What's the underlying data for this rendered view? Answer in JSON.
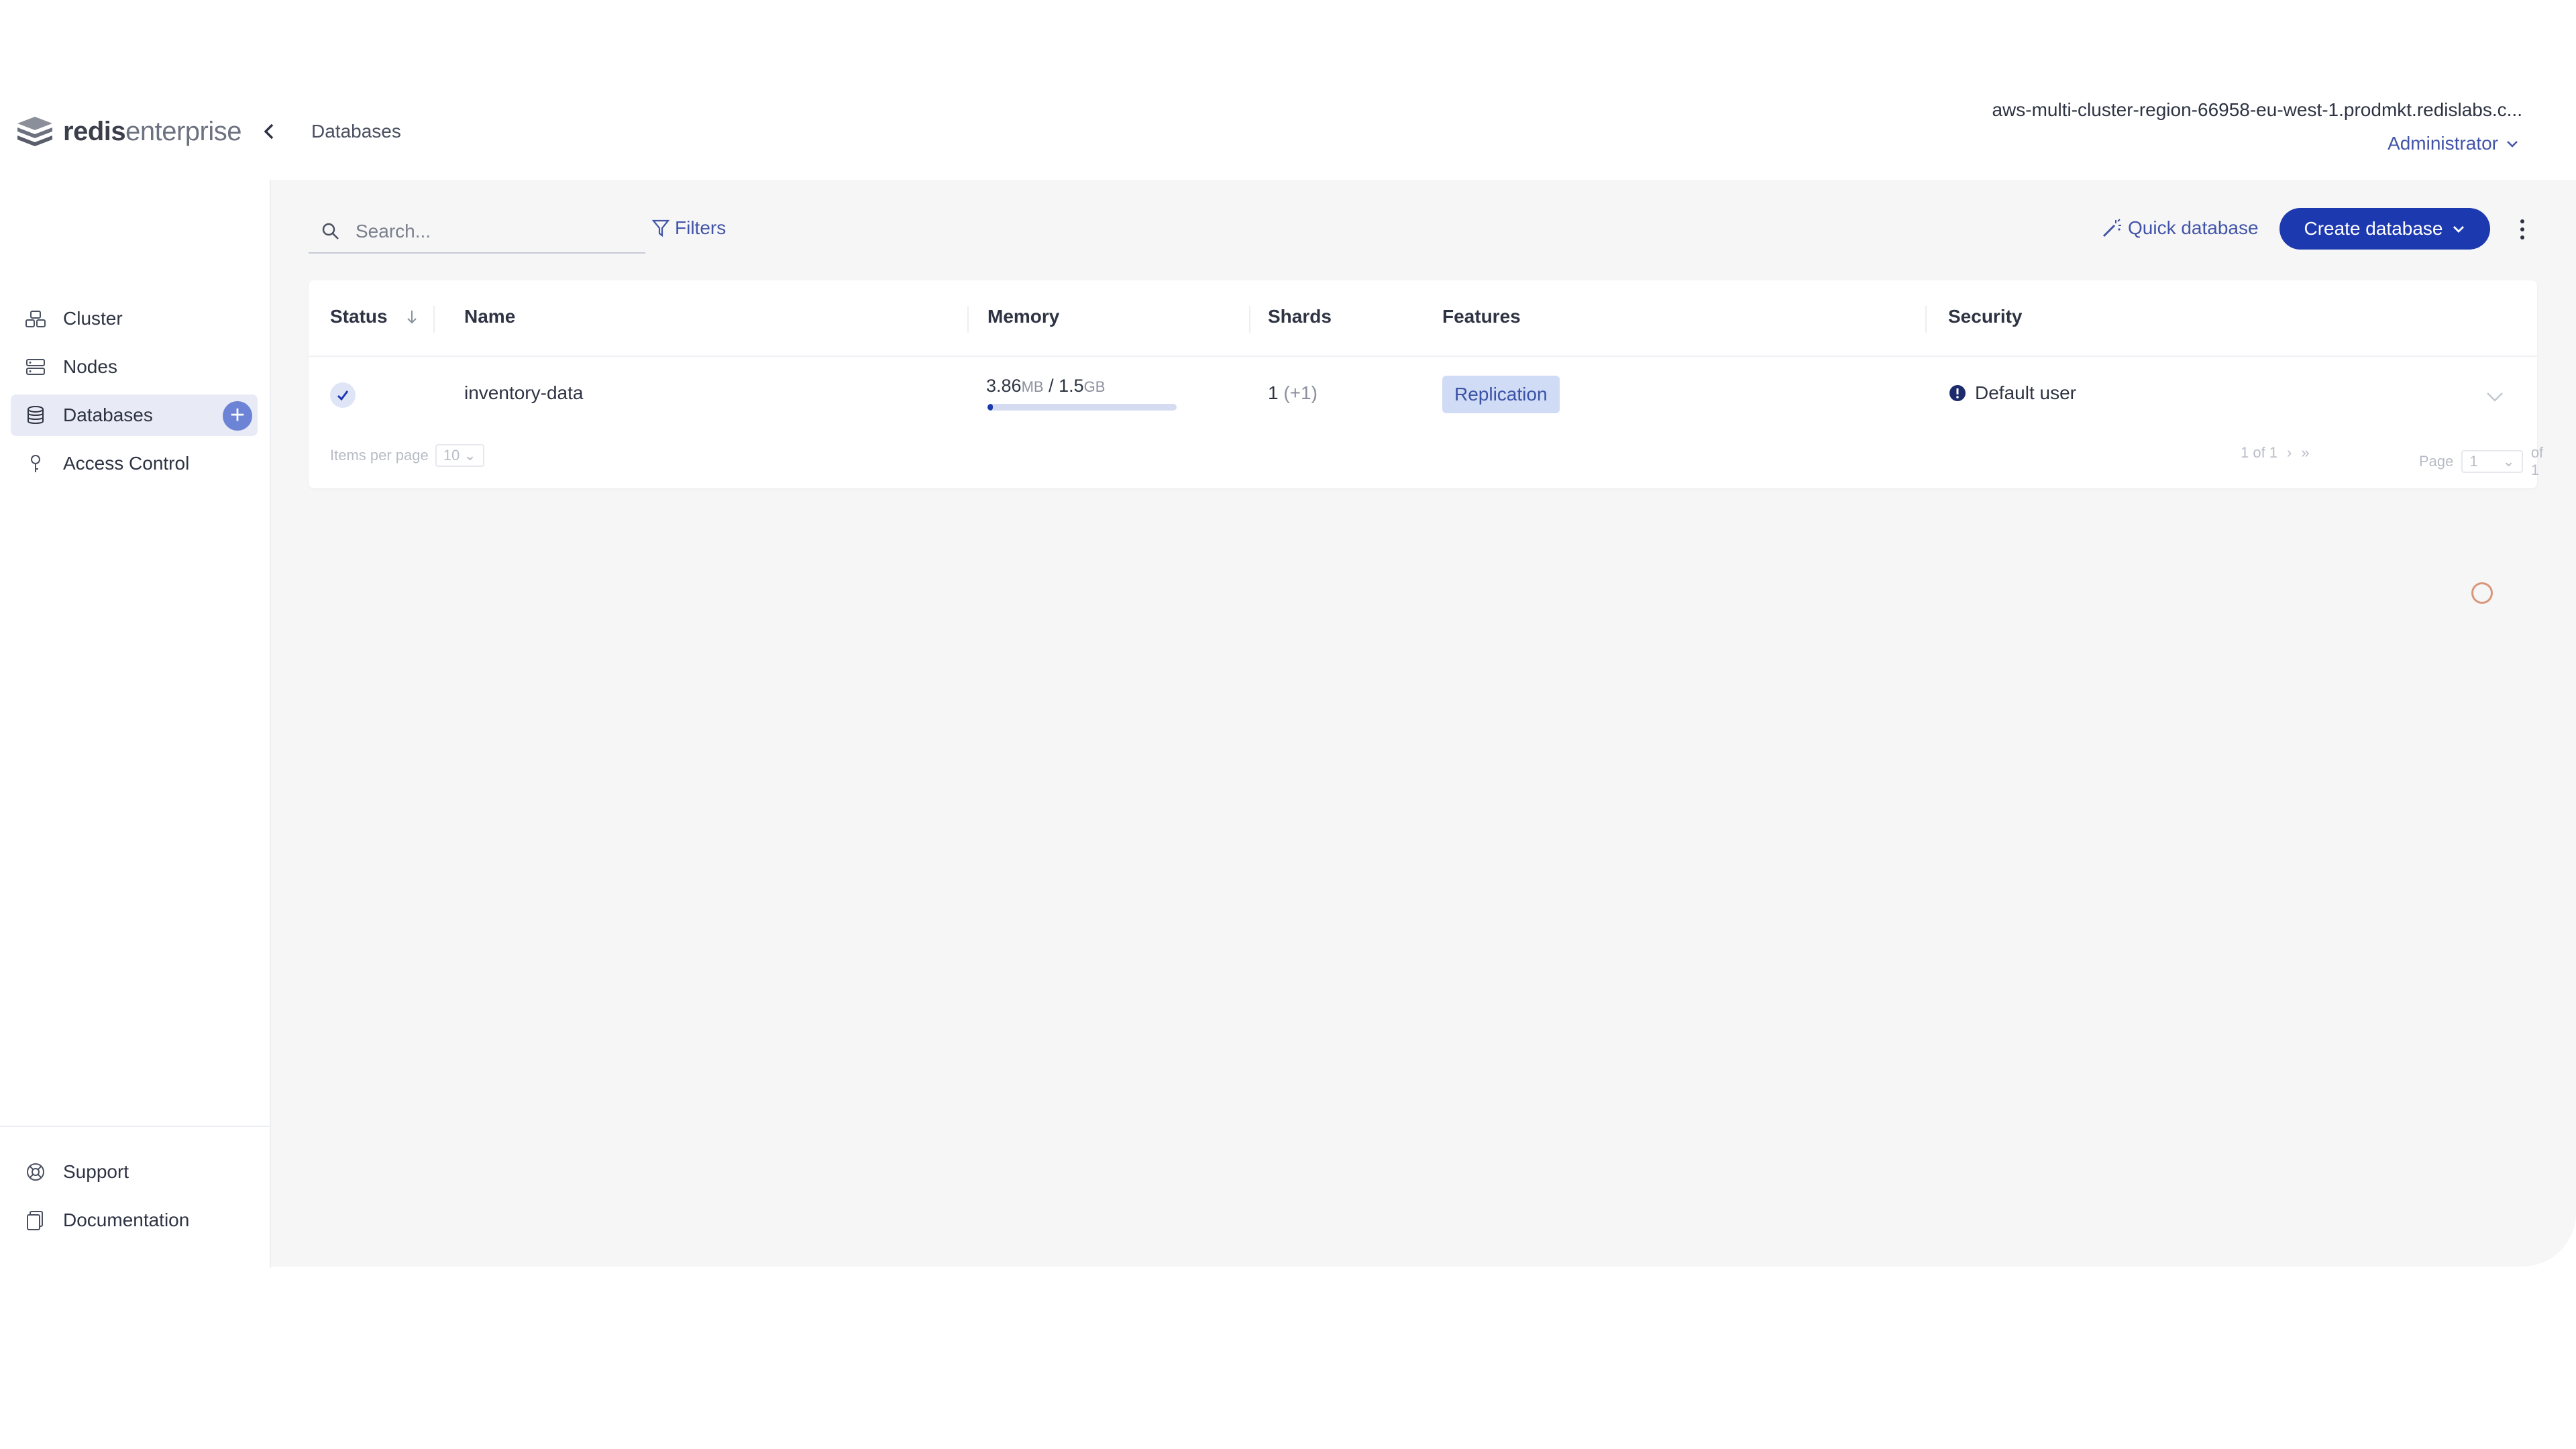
{
  "header": {
    "logo_bold": "redis",
    "logo_light": "enterprise",
    "breadcrumb": "Databases",
    "cluster_name": "aws-multi-cluster-region-66958-eu-west-1.prodmkt.redislabs.c...",
    "role": "Administrator"
  },
  "sidebar": {
    "items": [
      {
        "label": "Cluster",
        "icon": "cluster-icon"
      },
      {
        "label": "Nodes",
        "icon": "nodes-icon"
      },
      {
        "label": "Databases",
        "icon": "database-icon",
        "active": true
      },
      {
        "label": "Access Control",
        "icon": "key-icon"
      }
    ],
    "footer": [
      {
        "label": "Support",
        "icon": "lifebuoy-icon"
      },
      {
        "label": "Documentation",
        "icon": "docs-icon"
      }
    ],
    "add_glyph": "+"
  },
  "toolbar": {
    "search_placeholder": "Search...",
    "filters_label": "Filters",
    "quick_label": "Quick database",
    "create_label": "Create database"
  },
  "table": {
    "headers": [
      "Status",
      "Name",
      "Memory",
      "Shards",
      "Features",
      "Security"
    ],
    "rows": [
      {
        "name": "inventory-data",
        "memory_used": "3.86",
        "memory_used_unit": "MB",
        "memory_sep": " / ",
        "memory_total": "1.5",
        "memory_total_unit": "GB",
        "memory_fraction": 0.03,
        "shards": "1",
        "shards_extra": "(+1)",
        "feature": "Replication",
        "security": "Default user"
      }
    ],
    "footer": {
      "items_per_page_label": "Items per page",
      "items_per_page_value": "10",
      "range": "1 of 1",
      "page_label": "Page",
      "page_value": "1",
      "page_of": "of 1"
    }
  },
  "colors": {
    "accent": "#1d39b0",
    "link": "#4254a8",
    "tag_bg": "#d0dbf5"
  }
}
